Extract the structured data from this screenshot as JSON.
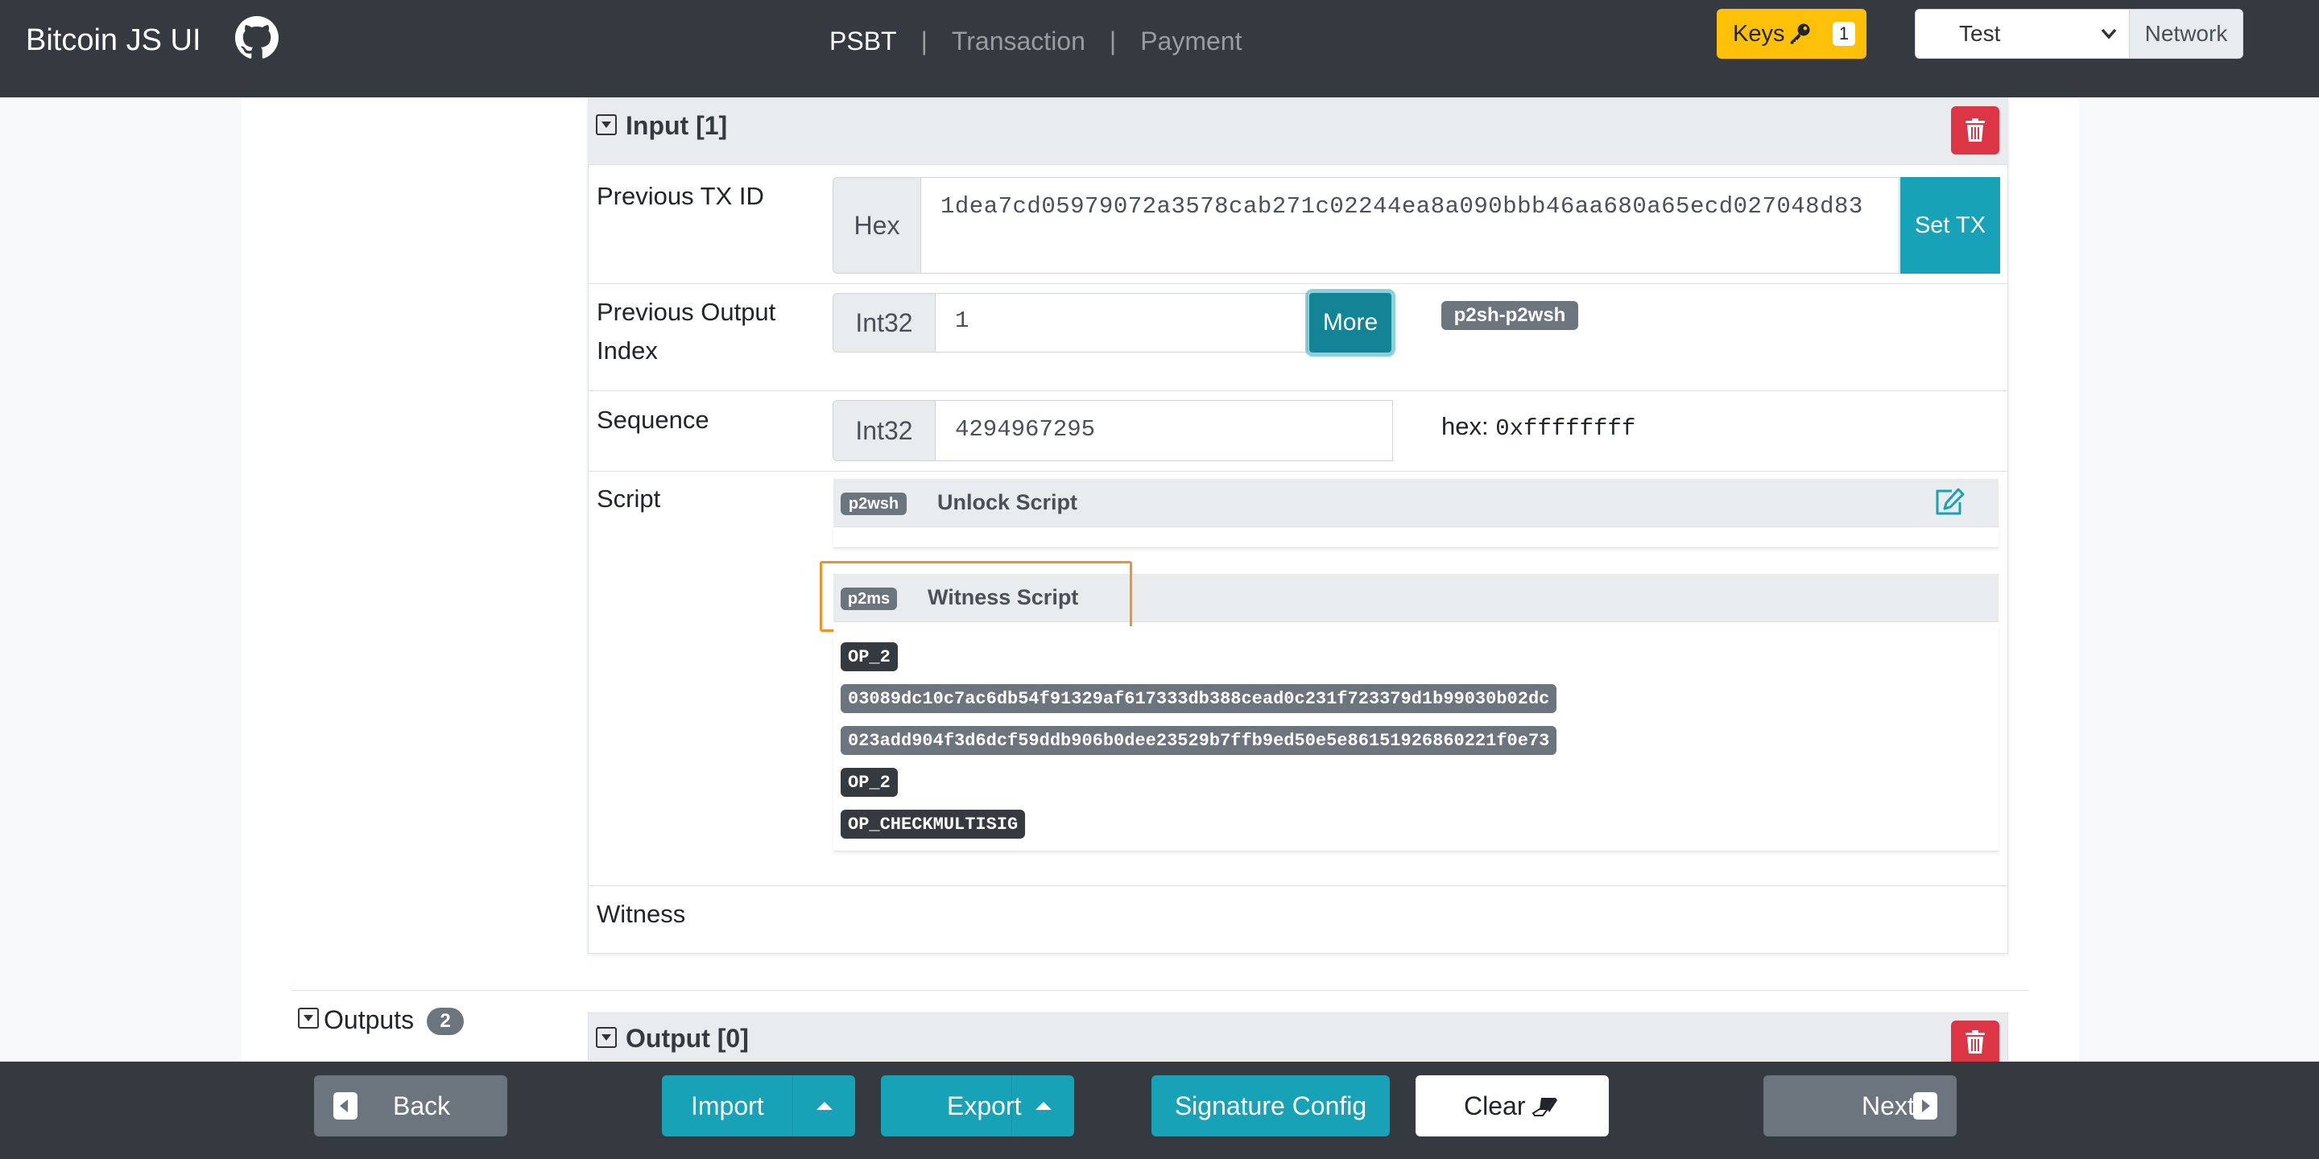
{
  "navbar": {
    "brand": "Bitcoin JS UI",
    "links": {
      "psbt": "PSBT",
      "transaction": "Transaction",
      "payment": "Payment"
    },
    "separator": "|",
    "keys_label": "Keys",
    "keys_count": "1",
    "network_selected": "Test",
    "network_label": "Network"
  },
  "input": {
    "title": "Input [1]",
    "prev_txid": {
      "label": "Previous TX ID",
      "addon": "Hex",
      "value": "1dea7cd05979072a3578cab271c02244ea8a090bbb46aa680a65ecd027048d83",
      "button": "Set TX"
    },
    "prev_output_index": {
      "label_line1": "Previous Output",
      "label_line2": "Index",
      "addon": "Int32",
      "value": "1",
      "button": "More",
      "type_badge": "p2sh-p2wsh"
    },
    "sequence": {
      "label": "Sequence",
      "addon": "Int32",
      "value": "4294967295",
      "hex_label": "hex:",
      "hex_value": "0xffffffff"
    },
    "script": {
      "label": "Script",
      "unlock": {
        "badge": "p2wsh",
        "title": "Unlock Script"
      },
      "witness": {
        "badge": "p2ms",
        "title": "Witness Script"
      },
      "ops": [
        "OP_2",
        "03089dc10c7ac6db54f91329af617333db388cead0c231f723379d1b99030b02dc",
        "023add904f3d6dcf59ddb906b0dee23529b7ffb9ed50e5e86151926860221f0e73",
        "OP_2",
        "OP_CHECKMULTISIG"
      ]
    },
    "witness_label": "Witness"
  },
  "outputs": {
    "label": "Outputs",
    "count": "2",
    "first_title": "Output [0]"
  },
  "footer": {
    "back": "Back",
    "import": "Import",
    "export": "Export",
    "signature_config": "Signature Config",
    "clear": "Clear",
    "next": "Next"
  },
  "colors": {
    "navbar": "#343a40",
    "teal": "#17a2b8",
    "danger": "#dc3545",
    "warning": "#ffc107",
    "secondary": "#6c757d",
    "highlight": "#f0912c"
  }
}
